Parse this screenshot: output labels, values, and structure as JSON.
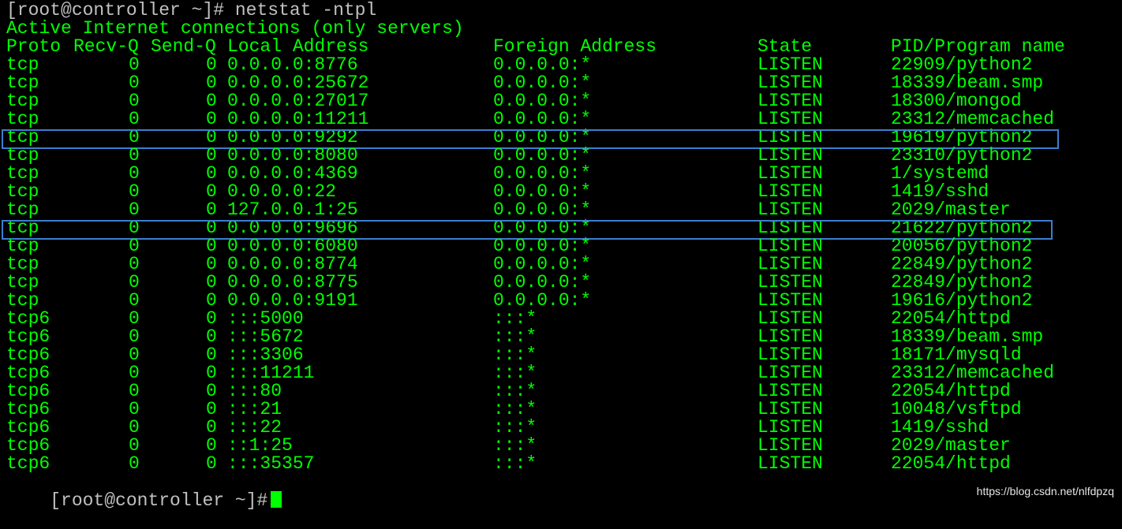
{
  "terminal": {
    "command_prompt": "[root@controller ~]# netstat -ntpl",
    "title": "Active Internet connections (only servers)",
    "headers": {
      "proto": "Proto",
      "recvq": "Recv-Q",
      "sendq": "Send-Q",
      "local": "Local Address",
      "foreign": "Foreign Address",
      "state": "State",
      "pid": "PID/Program name"
    },
    "rows": [
      {
        "proto": "tcp",
        "recvq": "0",
        "sendq": "0",
        "local": "0.0.0.0:8776",
        "foreign": "0.0.0.0:*",
        "state": "LISTEN",
        "pid": "22909/python2"
      },
      {
        "proto": "tcp",
        "recvq": "0",
        "sendq": "0",
        "local": "0.0.0.0:25672",
        "foreign": "0.0.0.0:*",
        "state": "LISTEN",
        "pid": "18339/beam.smp"
      },
      {
        "proto": "tcp",
        "recvq": "0",
        "sendq": "0",
        "local": "0.0.0.0:27017",
        "foreign": "0.0.0.0:*",
        "state": "LISTEN",
        "pid": "18300/mongod"
      },
      {
        "proto": "tcp",
        "recvq": "0",
        "sendq": "0",
        "local": "0.0.0.0:11211",
        "foreign": "0.0.0.0:*",
        "state": "LISTEN",
        "pid": "23312/memcached"
      },
      {
        "proto": "tcp",
        "recvq": "0",
        "sendq": "0",
        "local": "0.0.0.0:9292",
        "foreign": "0.0.0.0:*",
        "state": "LISTEN",
        "pid": "19619/python2",
        "highlighted": true
      },
      {
        "proto": "tcp",
        "recvq": "0",
        "sendq": "0",
        "local": "0.0.0.0:8080",
        "foreign": "0.0.0.0:*",
        "state": "LISTEN",
        "pid": "23310/python2"
      },
      {
        "proto": "tcp",
        "recvq": "0",
        "sendq": "0",
        "local": "0.0.0.0:4369",
        "foreign": "0.0.0.0:*",
        "state": "LISTEN",
        "pid": "1/systemd"
      },
      {
        "proto": "tcp",
        "recvq": "0",
        "sendq": "0",
        "local": "0.0.0.0:22",
        "foreign": "0.0.0.0:*",
        "state": "LISTEN",
        "pid": "1419/sshd"
      },
      {
        "proto": "tcp",
        "recvq": "0",
        "sendq": "0",
        "local": "127.0.0.1:25",
        "foreign": "0.0.0.0:*",
        "state": "LISTEN",
        "pid": "2029/master"
      },
      {
        "proto": "tcp",
        "recvq": "0",
        "sendq": "0",
        "local": "0.0.0.0:9696",
        "foreign": "0.0.0.0:*",
        "state": "LISTEN",
        "pid": "21622/python2",
        "highlighted": true
      },
      {
        "proto": "tcp",
        "recvq": "0",
        "sendq": "0",
        "local": "0.0.0.0:6080",
        "foreign": "0.0.0.0:*",
        "state": "LISTEN",
        "pid": "20056/python2"
      },
      {
        "proto": "tcp",
        "recvq": "0",
        "sendq": "0",
        "local": "0.0.0.0:8774",
        "foreign": "0.0.0.0:*",
        "state": "LISTEN",
        "pid": "22849/python2"
      },
      {
        "proto": "tcp",
        "recvq": "0",
        "sendq": "0",
        "local": "0.0.0.0:8775",
        "foreign": "0.0.0.0:*",
        "state": "LISTEN",
        "pid": "22849/python2"
      },
      {
        "proto": "tcp",
        "recvq": "0",
        "sendq": "0",
        "local": "0.0.0.0:9191",
        "foreign": "0.0.0.0:*",
        "state": "LISTEN",
        "pid": "19616/python2"
      },
      {
        "proto": "tcp6",
        "recvq": "0",
        "sendq": "0",
        "local": ":::5000",
        "foreign": ":::*",
        "state": "LISTEN",
        "pid": "22054/httpd"
      },
      {
        "proto": "tcp6",
        "recvq": "0",
        "sendq": "0",
        "local": ":::5672",
        "foreign": ":::*",
        "state": "LISTEN",
        "pid": "18339/beam.smp"
      },
      {
        "proto": "tcp6",
        "recvq": "0",
        "sendq": "0",
        "local": ":::3306",
        "foreign": ":::*",
        "state": "LISTEN",
        "pid": "18171/mysqld"
      },
      {
        "proto": "tcp6",
        "recvq": "0",
        "sendq": "0",
        "local": ":::11211",
        "foreign": ":::*",
        "state": "LISTEN",
        "pid": "23312/memcached"
      },
      {
        "proto": "tcp6",
        "recvq": "0",
        "sendq": "0",
        "local": ":::80",
        "foreign": ":::*",
        "state": "LISTEN",
        "pid": "22054/httpd"
      },
      {
        "proto": "tcp6",
        "recvq": "0",
        "sendq": "0",
        "local": ":::21",
        "foreign": ":::*",
        "state": "LISTEN",
        "pid": "10048/vsftpd"
      },
      {
        "proto": "tcp6",
        "recvq": "0",
        "sendq": "0",
        "local": ":::22",
        "foreign": ":::*",
        "state": "LISTEN",
        "pid": "1419/sshd"
      },
      {
        "proto": "tcp6",
        "recvq": "0",
        "sendq": "0",
        "local": "::1:25",
        "foreign": ":::*",
        "state": "LISTEN",
        "pid": "2029/master"
      },
      {
        "proto": "tcp6",
        "recvq": "0",
        "sendq": "0",
        "local": ":::35357",
        "foreign": ":::*",
        "state": "LISTEN",
        "pid": "22054/httpd"
      }
    ],
    "final_prompt": "[root@controller ~]#"
  },
  "watermark": "https://blog.csdn.net/nlfdpzq",
  "colors": {
    "background": "#000000",
    "text": "#00ff00",
    "prompt": "#c0c0c0",
    "highlight_box": "#3a7fd0"
  }
}
